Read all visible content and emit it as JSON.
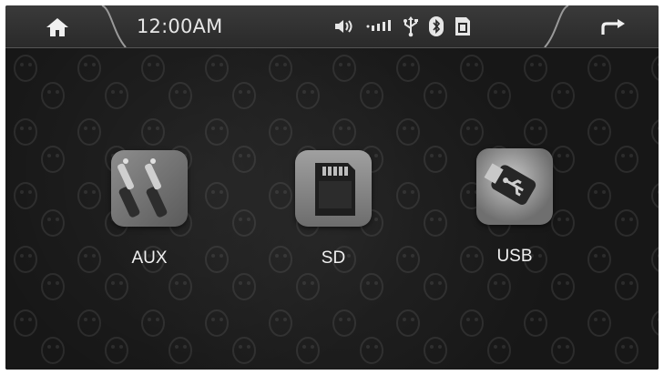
{
  "status_bar": {
    "time": "12:00AM",
    "icons": [
      "home-icon",
      "volume-icon",
      "signal-icon",
      "usb-icon",
      "bluetooth-icon",
      "sd-card-icon",
      "back-icon"
    ]
  },
  "apps": [
    {
      "id": "aux",
      "label": "AUX",
      "icon": "aux-cable-icon"
    },
    {
      "id": "sd",
      "label": "SD",
      "icon": "sd-card-icon"
    },
    {
      "id": "usb",
      "label": "USB",
      "icon": "usb-drive-icon"
    }
  ],
  "colors": {
    "background": "#1e1e1e",
    "text": "#e6e6e6"
  }
}
